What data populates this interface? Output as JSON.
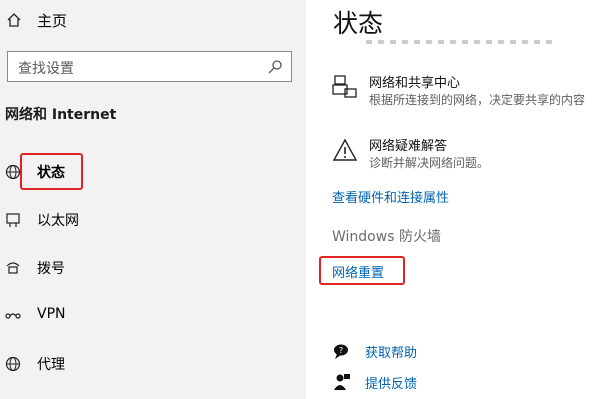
{
  "sidebar": {
    "home_label": "主页",
    "search_placeholder": "查找设置",
    "section_title": "网络和 Internet",
    "items": [
      {
        "label": "状态",
        "icon": "globe-icon"
      },
      {
        "label": "以太网",
        "icon": "ethernet-icon"
      },
      {
        "label": "拨号",
        "icon": "dialup-icon"
      },
      {
        "label": "VPN",
        "icon": "vpn-icon"
      },
      {
        "label": "代理",
        "icon": "globe-proxy-icon"
      }
    ]
  },
  "main": {
    "title": "状态",
    "sharing_center": {
      "title": "网络和共享中心",
      "desc": "根据所连接到的网络，决定要共享的内容"
    },
    "troubleshooter": {
      "title": "网络疑难解答",
      "desc": "诊断并解决网络问题。"
    },
    "hardware_link": "查看硬件和连接属性",
    "firewall_label": "Windows 防火墙",
    "reset_link": "网络重置",
    "get_help": "获取帮助",
    "feedback": "提供反馈"
  },
  "colors": {
    "accent": "#0063b1",
    "highlight": "#e02424",
    "sidebar_bg": "#f2f2f2"
  }
}
